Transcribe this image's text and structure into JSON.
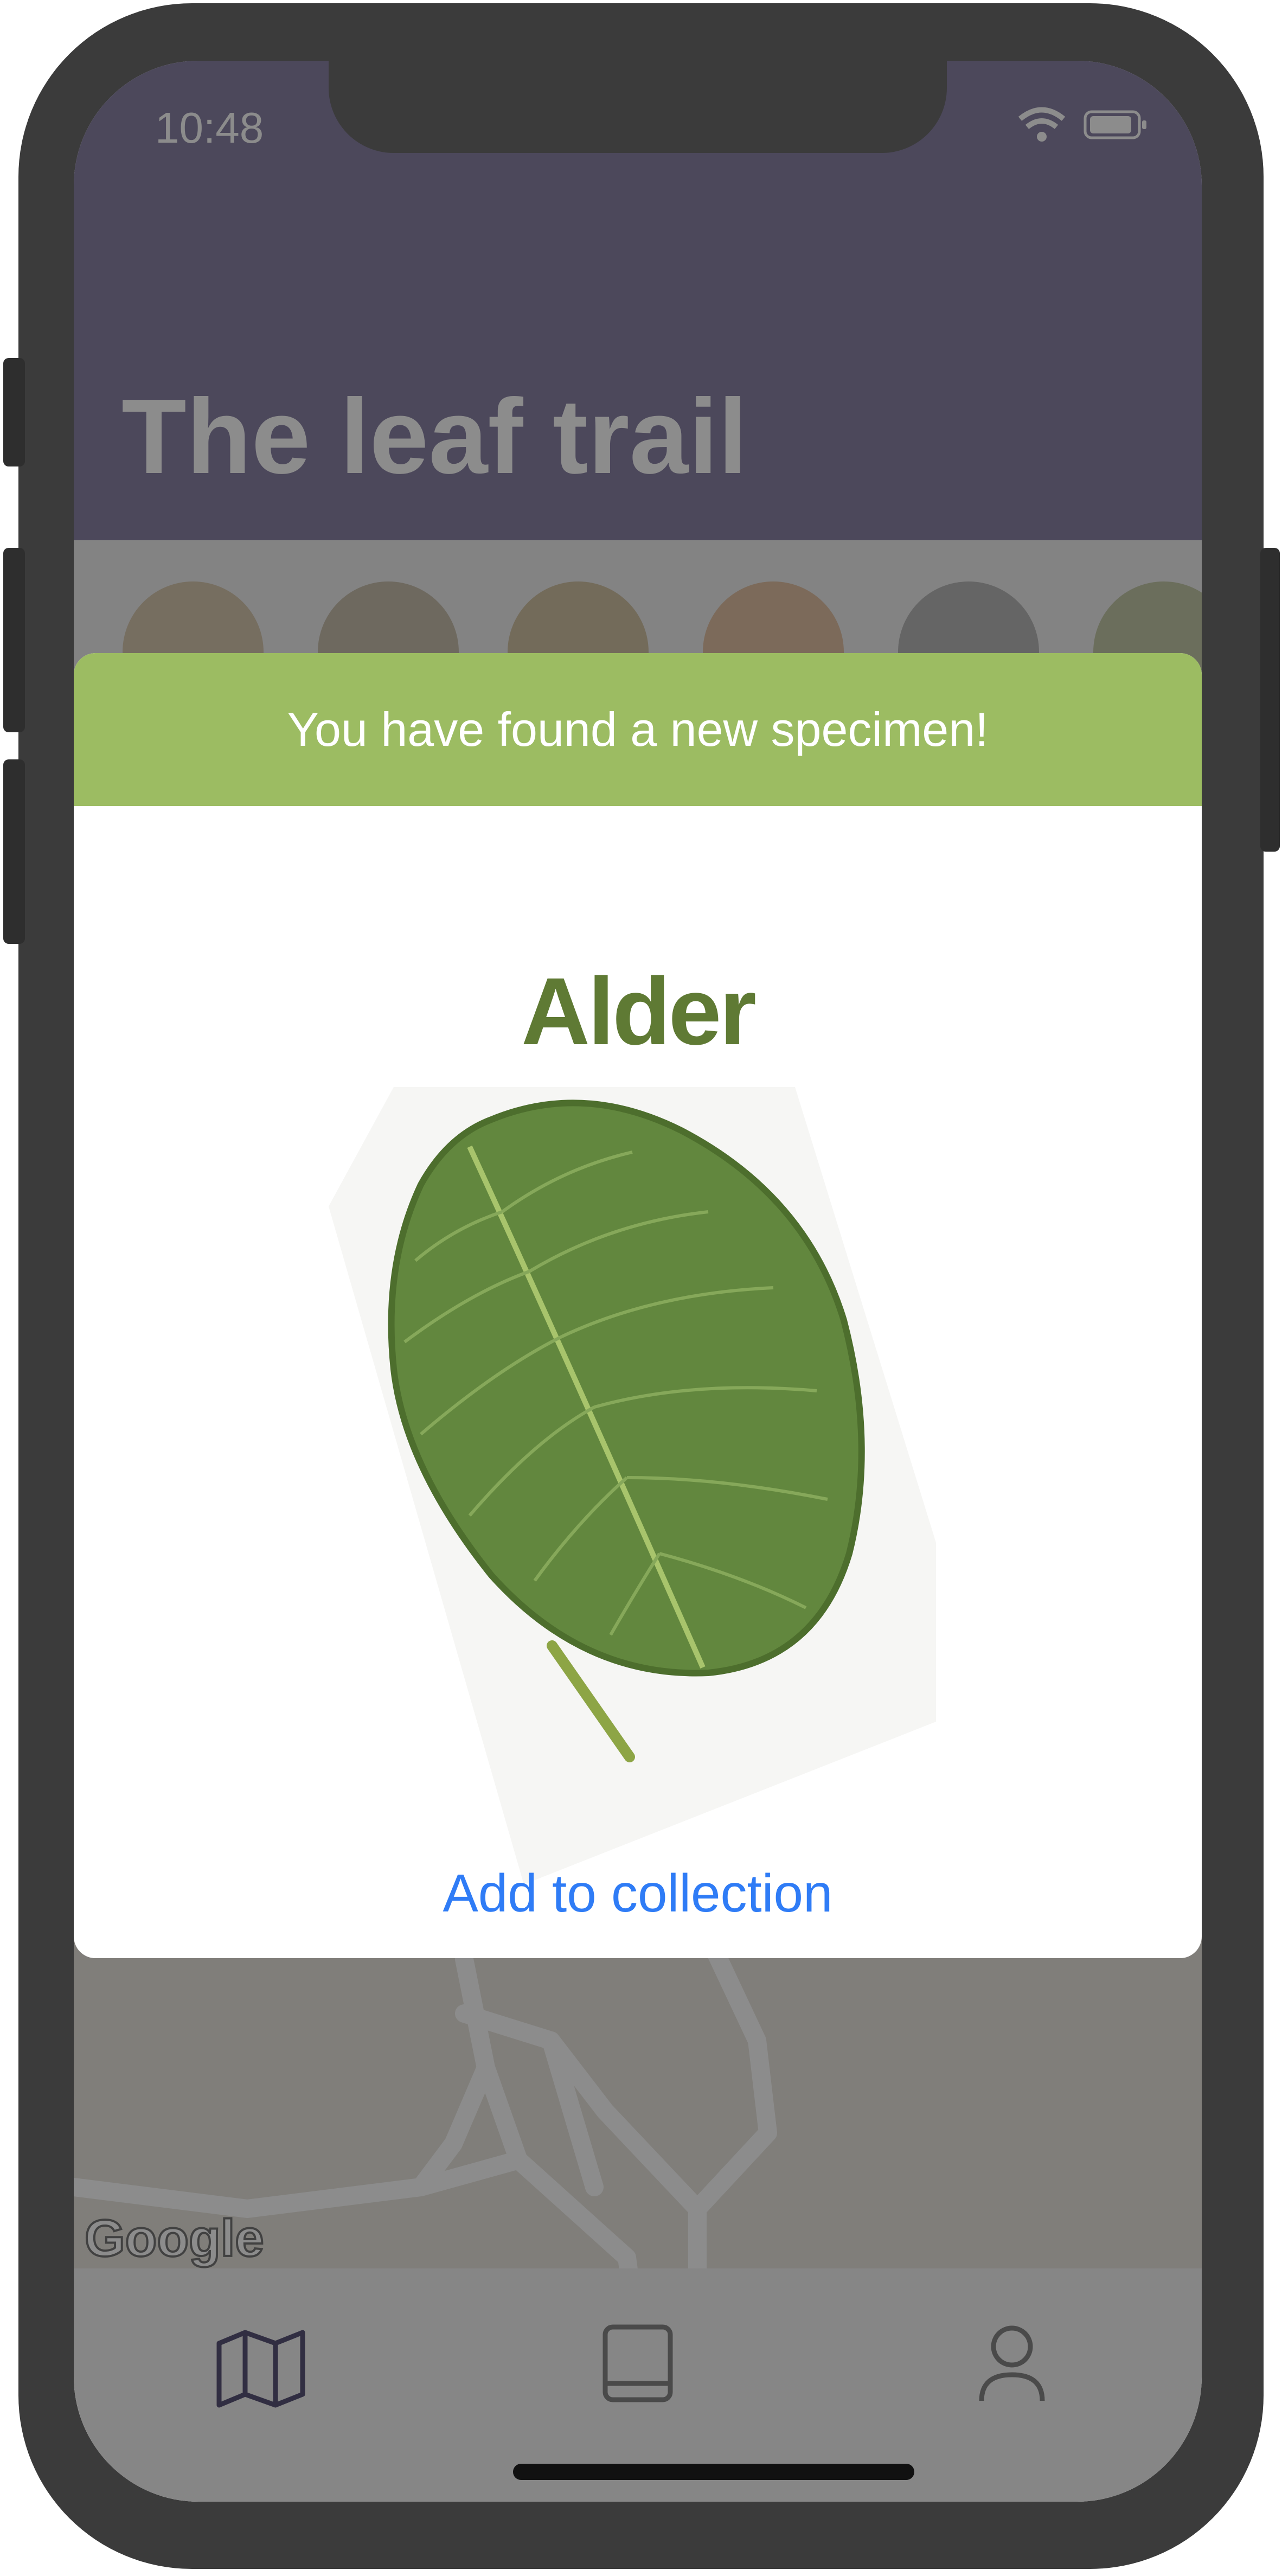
{
  "status_bar": {
    "time": "10:48"
  },
  "header": {
    "title": "The leaf trail"
  },
  "map": {
    "attribution": "Google"
  },
  "modal": {
    "banner_text": "You have found a new specimen!",
    "species_name": "Alder",
    "add_button_label": "Add to collection"
  },
  "tab_bar": {
    "items": [
      "map",
      "book",
      "profile"
    ]
  },
  "colors": {
    "banner": "#9cbc62",
    "species_title": "#5f7a34",
    "link": "#2f7cf6",
    "header": "#8b83a6"
  },
  "icons": [
    "wifi-icon",
    "battery-icon",
    "map-icon",
    "book-icon",
    "profile-icon",
    "leaf-image"
  ]
}
